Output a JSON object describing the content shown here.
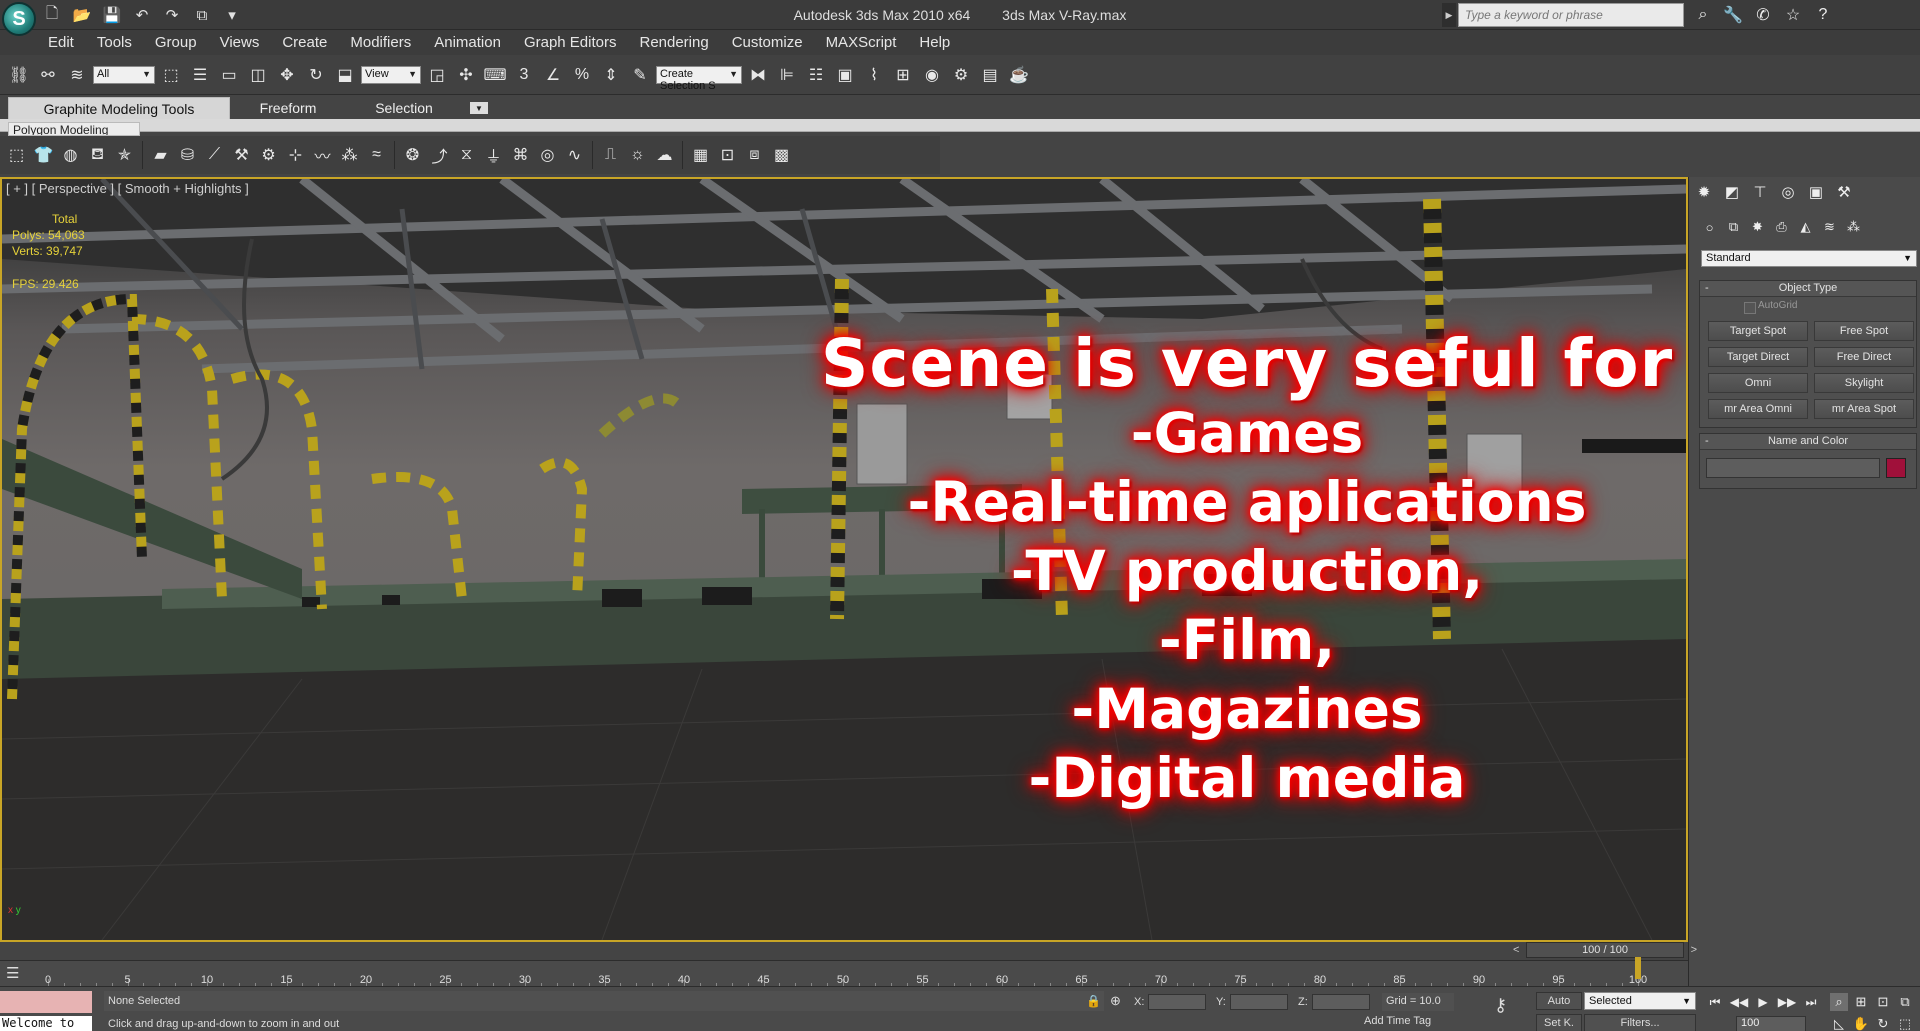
{
  "titlebar": {
    "app_logo_text": "S",
    "app_name": "Autodesk 3ds Max  2010 x64",
    "file_name": "3ds Max V-Ray.max",
    "search_placeholder": "Type a keyword or phrase"
  },
  "menu": [
    "Edit",
    "Tools",
    "Group",
    "Views",
    "Create",
    "Modifiers",
    "Animation",
    "Graph Editors",
    "Rendering",
    "Customize",
    "MAXScript",
    "Help"
  ],
  "main_toolbar": {
    "filter_select": "All",
    "ref_coord_select": "View",
    "snap_label": "3",
    "named_selection_placeholder": "Create Selection S"
  },
  "ribbon": {
    "tabs": [
      "Graphite Modeling Tools",
      "Freeform",
      "Selection"
    ],
    "subtab": "Polygon Modeling"
  },
  "viewport": {
    "label": "[ + ] [ Perspective ] [ Smooth + Highlights ]",
    "stats_total": "Total",
    "polys": "Polys:  54,063",
    "verts": "Verts:  39,747",
    "fps": "FPS:    29.426",
    "axis_x": "x",
    "axis_y": "y"
  },
  "promo": {
    "headline": "Scene is very seful for",
    "lines": [
      "-Games",
      "-Real-time aplications",
      "-TV production,",
      "-Film,",
      "-Magazines",
      "-Digital media"
    ]
  },
  "command_panel": {
    "category": "Standard",
    "object_type_title": "Object Type",
    "autogrid": "AutoGrid",
    "buttons": [
      "Target Spot",
      "Free Spot",
      "Target Direct",
      "Free Direct",
      "Omni",
      "Skylight",
      "mr Area Omni",
      "mr Area Spot"
    ],
    "name_color_title": "Name and Color",
    "swatch_color": "#a0103a"
  },
  "timeline": {
    "slider_text": "100 / 100",
    "ticks": [
      "0",
      "5",
      "10",
      "15",
      "20",
      "25",
      "30",
      "35",
      "40",
      "45",
      "50",
      "55",
      "60",
      "65",
      "70",
      "75",
      "80",
      "85",
      "90",
      "95",
      "100"
    ],
    "current_frame": 100
  },
  "status": {
    "listener": "Welcome to",
    "selection": "None Selected",
    "hint": "Click and drag up-and-down to zoom in and out",
    "x_label": "X:",
    "y_label": "Y:",
    "z_label": "Z:",
    "grid": "Grid = 10.0",
    "add_time_tag": "Add Time Tag",
    "auto_key": "Auto",
    "set_key": "Set K.",
    "key_filter_select": "Selected",
    "filters": "Filters...",
    "frame": "100"
  }
}
